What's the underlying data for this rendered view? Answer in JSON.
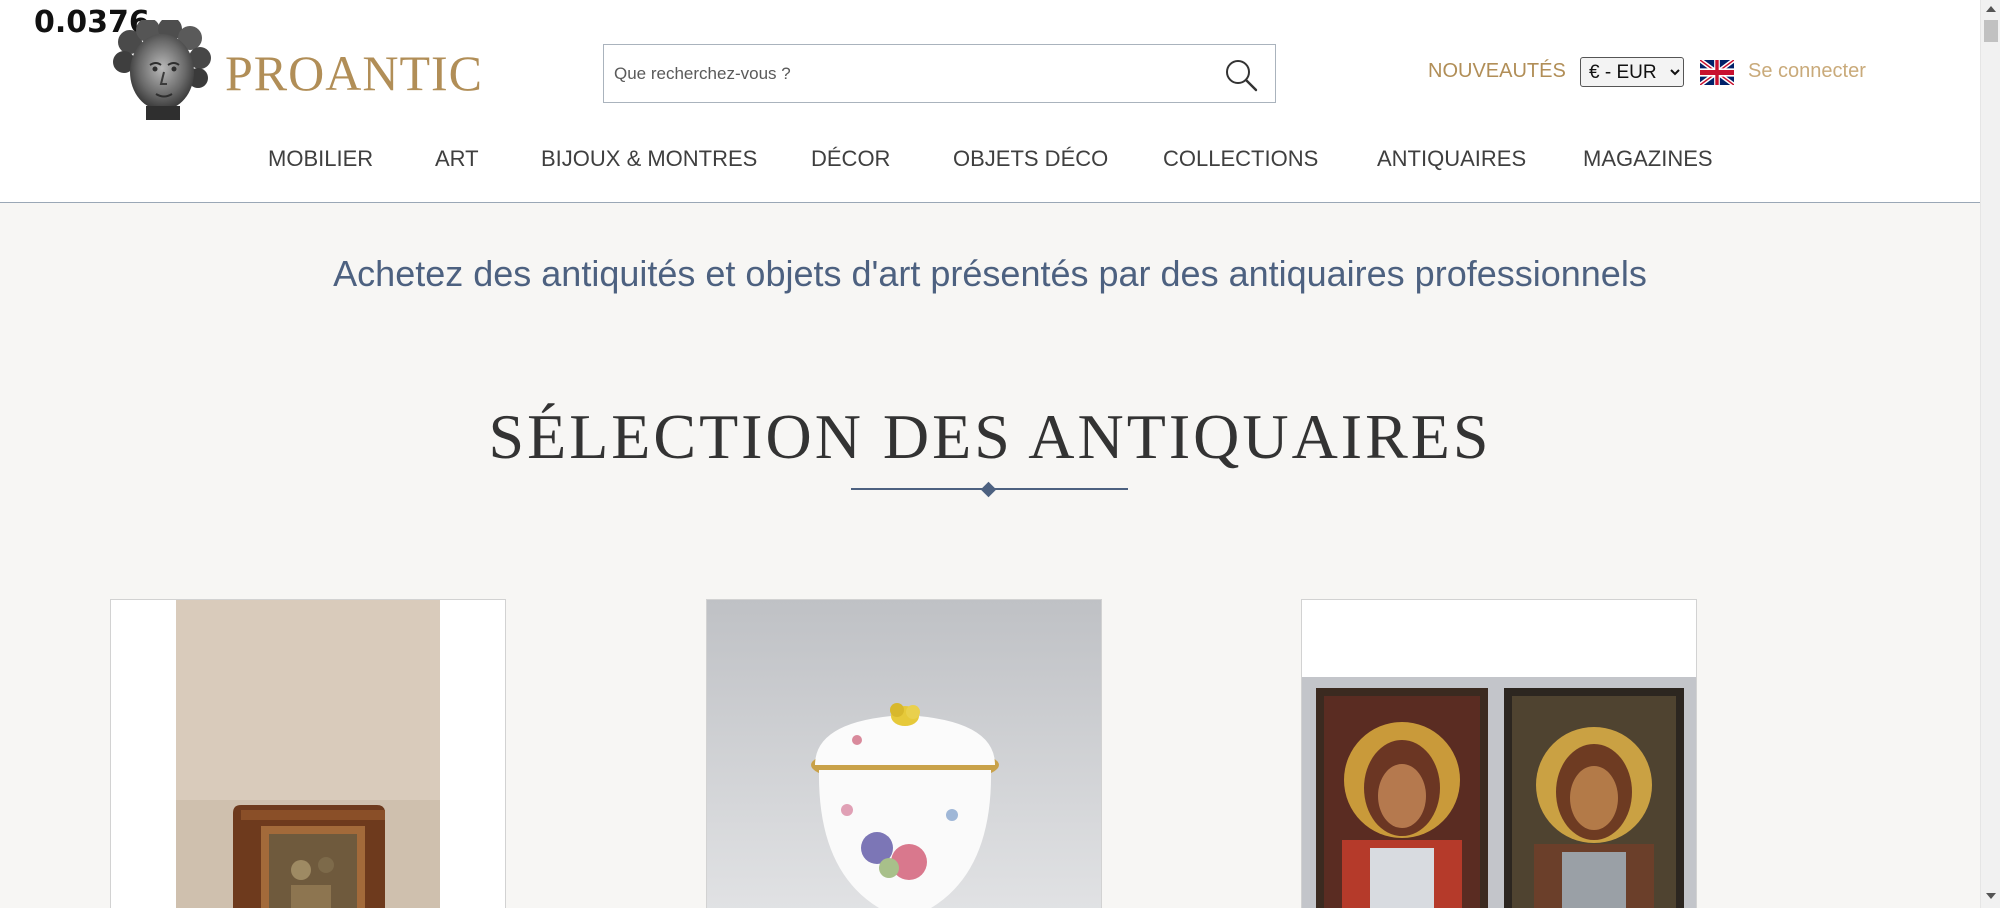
{
  "debug_overlay": "0.0376",
  "header": {
    "logo_text": "PROANTIC",
    "search_placeholder": "Que recherchez-vous ?",
    "new_link": "NOUVEAUTÉS",
    "currency_selected": "€ - EUR",
    "currency_options": [
      "€ - EUR"
    ],
    "language_flag": "uk-flag-icon",
    "login_label": "Se connecter"
  },
  "nav": {
    "items": [
      {
        "label": "MOBILIER"
      },
      {
        "label": "ART"
      },
      {
        "label": "BIJOUX & MONTRES"
      },
      {
        "label": "DÉCOR"
      },
      {
        "label": "OBJETS DÉCO"
      },
      {
        "label": "COLLECTIONS"
      },
      {
        "label": "ANTIQUAIRES"
      },
      {
        "label": "MAGAZINES"
      }
    ]
  },
  "main": {
    "tagline": "Achetez des antiquités et objets d'art présentés par des antiquaires professionnels",
    "section_title": "SÉLECTION DES ANTIQUAIRES"
  },
  "colors": {
    "brand_gold": "#b18e57",
    "accent_blue": "#4d6180",
    "background": "#f7f6f4"
  }
}
